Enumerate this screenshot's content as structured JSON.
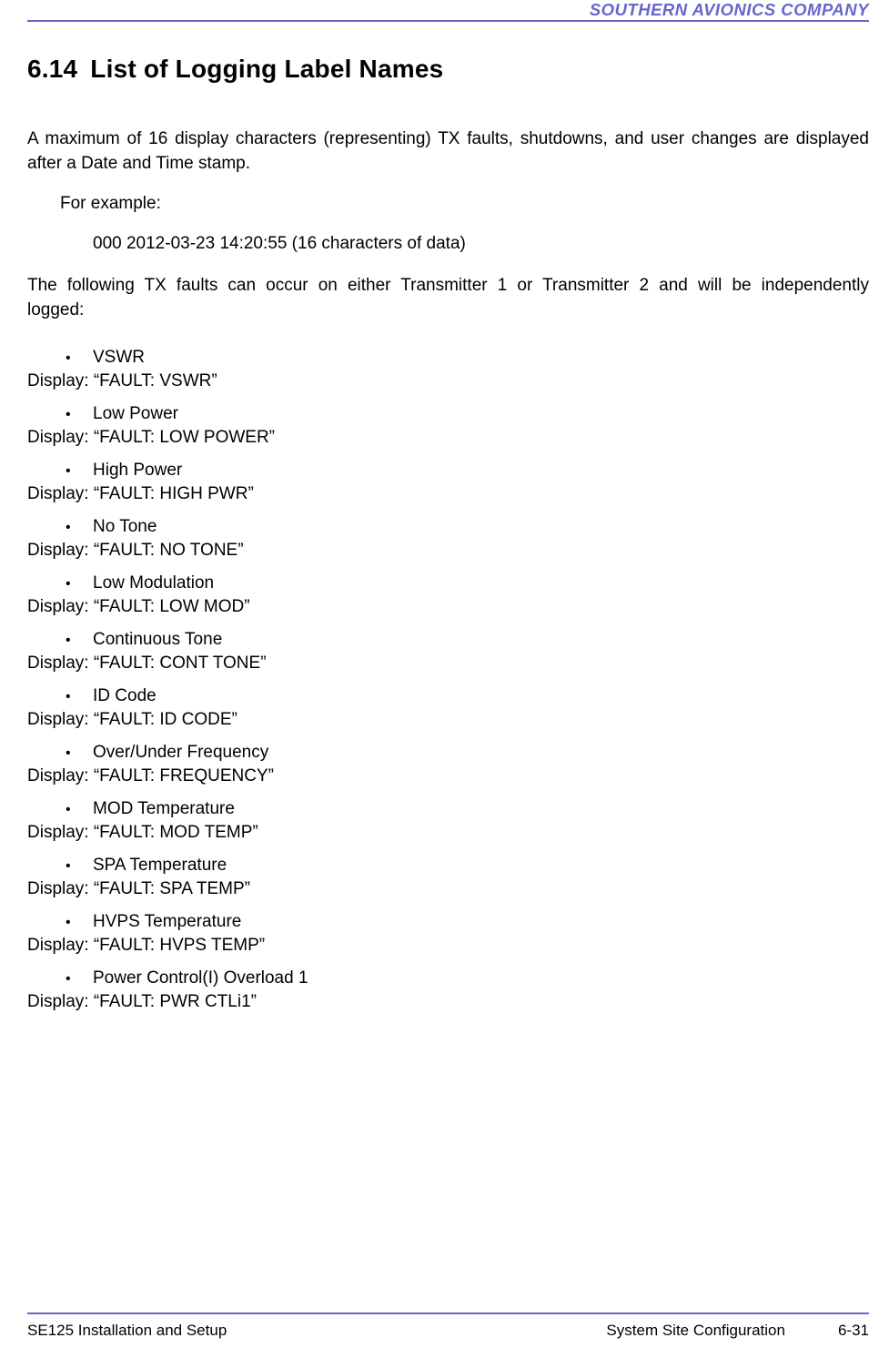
{
  "header": {
    "company": "SOUTHERN AVIONICS COMPANY"
  },
  "section": {
    "number": "6.14",
    "title": "List of Logging Label Names"
  },
  "intro_para": "A maximum of 16 display characters (representing) TX faults, shutdowns, and user changes are displayed after a Date and Time stamp.",
  "example_label": "For example:",
  "example_line": "000 2012-03-23 14:20:55 (16 characters of data)",
  "faults_intro": "The following TX faults can occur on either Transmitter 1 or Transmitter 2 and will be independently logged:",
  "faults": [
    {
      "name": "VSWR",
      "display": "Display: “FAULT: VSWR”"
    },
    {
      "name": "Low Power",
      "display": "Display: “FAULT: LOW POWER”"
    },
    {
      "name": "High Power",
      "display": "Display: “FAULT: HIGH PWR”"
    },
    {
      "name": "No Tone",
      "display": "Display: “FAULT: NO TONE”"
    },
    {
      "name": "Low Modulation",
      "display": "Display: “FAULT: LOW MOD”"
    },
    {
      "name": "Continuous Tone",
      "display": "Display: “FAULT: CONT TONE”"
    },
    {
      "name": "ID Code",
      "display": "Display: “FAULT: ID CODE”"
    },
    {
      "name": "Over/Under Frequency",
      "display": "Display: “FAULT: FREQUENCY”"
    },
    {
      "name": "MOD Temperature",
      "display": "Display: “FAULT: MOD TEMP”"
    },
    {
      "name": "SPA Temperature",
      "display": "Display: “FAULT: SPA TEMP”"
    },
    {
      "name": "HVPS Temperature",
      "display": "Display: “FAULT: HVPS TEMP”"
    },
    {
      "name": "Power Control(I) Overload 1",
      "display": "Display: “FAULT: PWR CTLi1”"
    }
  ],
  "footer": {
    "left": "SE125 Installation and Setup",
    "center": "System Site Configuration",
    "page": "6-31"
  }
}
